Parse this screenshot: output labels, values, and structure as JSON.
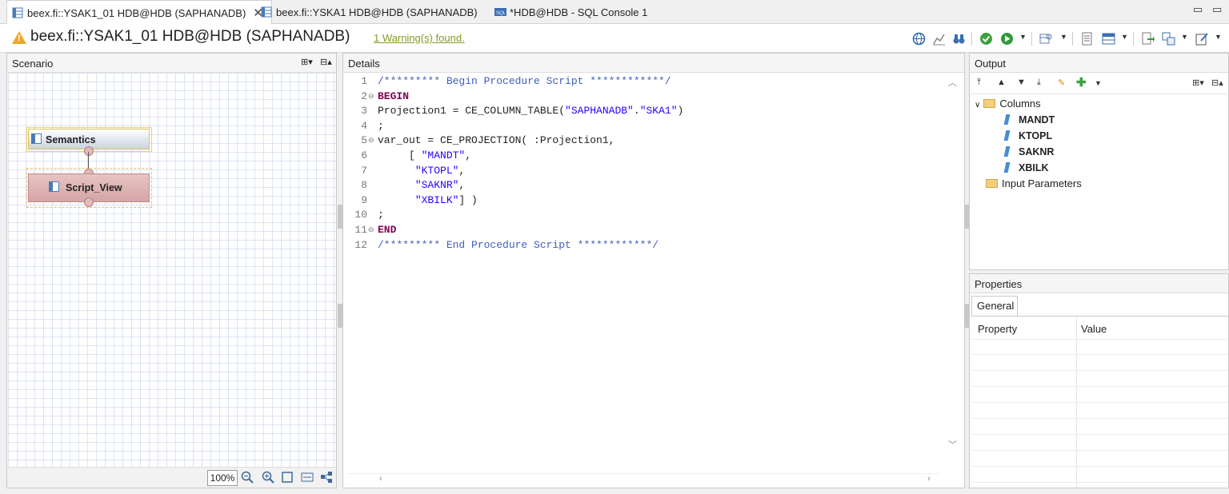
{
  "tabs": [
    {
      "label": "beex.fi::YSAK1_01 HDB@HDB (SAPHANADB)",
      "active": true,
      "close": "✕"
    },
    {
      "label": "beex.fi::YSKA1 HDB@HDB (SAPHANADB)",
      "active": false
    },
    {
      "label": "*HDB@HDB - SQL Console 1",
      "active": false
    }
  ],
  "window": {
    "minimize": "▭",
    "maximize": "▭"
  },
  "header": {
    "title": "beex.fi::YSAK1_01 HDB@HDB (SAPHANADB)",
    "warning": "1 Warning(s) found."
  },
  "scenario": {
    "title": "Scenario",
    "zoom": "100%",
    "nodes": {
      "semantics": "Semantics",
      "script_view": "Script_View"
    }
  },
  "details": {
    "title": "Details",
    "lines": [
      {
        "n": "1",
        "fold": "",
        "parts": [
          {
            "c": "cmt",
            "t": "/********* Begin Procedure Script ************/"
          }
        ]
      },
      {
        "n": "2",
        "fold": "⊖",
        "parts": [
          {
            "c": "kw",
            "t": "BEGIN"
          }
        ]
      },
      {
        "n": "3",
        "fold": "",
        "parts": [
          {
            "c": "",
            "t": "Projection1 = CE_COLUMN_TABLE("
          },
          {
            "c": "str",
            "t": "\"SAPHANADB\""
          },
          {
            "c": "",
            "t": "."
          },
          {
            "c": "str",
            "t": "\"SKA1\""
          },
          {
            "c": "",
            "t": ")"
          }
        ]
      },
      {
        "n": "4",
        "fold": "",
        "parts": [
          {
            "c": "",
            "t": ";"
          }
        ]
      },
      {
        "n": "5",
        "fold": "⊖",
        "parts": [
          {
            "c": "",
            "t": "var_out = CE_PROJECTION( :Projection1,"
          }
        ]
      },
      {
        "n": "6",
        "fold": "",
        "parts": [
          {
            "c": "",
            "t": "     [ "
          },
          {
            "c": "str",
            "t": "\"MANDT\""
          },
          {
            "c": "",
            "t": ","
          }
        ]
      },
      {
        "n": "7",
        "fold": "",
        "parts": [
          {
            "c": "",
            "t": "      "
          },
          {
            "c": "str",
            "t": "\"KTOPL\""
          },
          {
            "c": "",
            "t": ","
          }
        ]
      },
      {
        "n": "8",
        "fold": "",
        "parts": [
          {
            "c": "",
            "t": "      "
          },
          {
            "c": "str",
            "t": "\"SAKNR\""
          },
          {
            "c": "",
            "t": ","
          }
        ]
      },
      {
        "n": "9",
        "fold": "",
        "parts": [
          {
            "c": "",
            "t": "      "
          },
          {
            "c": "str",
            "t": "\"XBILK\""
          },
          {
            "c": "",
            "t": "] )"
          }
        ]
      },
      {
        "n": "10",
        "fold": "",
        "parts": [
          {
            "c": "",
            "t": ";"
          }
        ]
      },
      {
        "n": "11",
        "fold": "⊖",
        "parts": [
          {
            "c": "kw",
            "t": "END"
          }
        ]
      },
      {
        "n": "12",
        "fold": "",
        "parts": [
          {
            "c": "cmt",
            "t": "/********* End Procedure Script ************/"
          }
        ]
      }
    ]
  },
  "output": {
    "title": "Output",
    "columns_label": "Columns",
    "columns": [
      "MANDT",
      "KTOPL",
      "SAKNR",
      "XBILK"
    ],
    "input_params_label": "Input Parameters"
  },
  "properties": {
    "title": "Properties",
    "tab": "General",
    "col_property": "Property",
    "col_value": "Value"
  }
}
